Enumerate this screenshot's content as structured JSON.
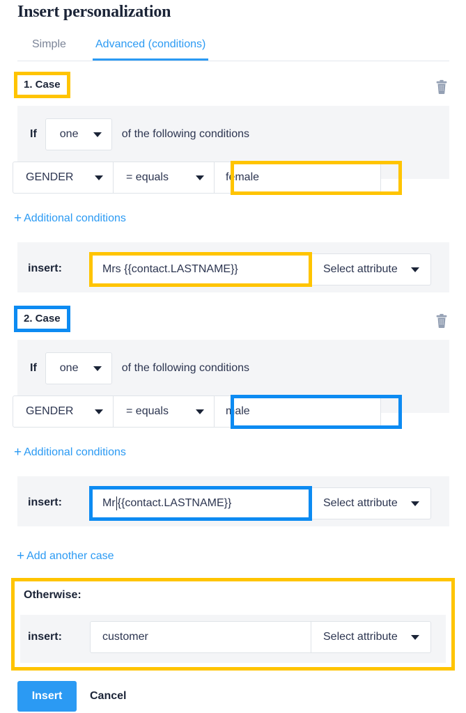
{
  "dialog": {
    "title": "Insert personalization",
    "tabs": [
      {
        "label": "Simple",
        "active": false
      },
      {
        "label": "Advanced (conditions)",
        "active": true
      }
    ],
    "accent_color": "#2b9af3",
    "highlight_yellow": "#ffc400",
    "highlight_blue": "#0d8bf2"
  },
  "cases": [
    {
      "label": "1. Case",
      "delete_icon": "trash-icon",
      "if_word": "If",
      "match_select": "one",
      "if_tail": "of the following conditions",
      "condition": {
        "attribute": "GENDER",
        "operator": "= equals",
        "value": "female"
      },
      "additional_conditions_link": "Additional conditions",
      "insert_label": "insert:",
      "insert_value": "Mrs {{contact.LASTNAME}}",
      "select_attribute": "Select attribute"
    },
    {
      "label": "2. Case",
      "delete_icon": "trash-icon",
      "if_word": "If",
      "match_select": "one",
      "if_tail": "of the following conditions",
      "condition": {
        "attribute": "GENDER",
        "operator": "= equals",
        "value": "male"
      },
      "additional_conditions_link": "Additional conditions",
      "insert_label": "insert:",
      "insert_value_before_cursor": "Mr ",
      "insert_value_after_cursor": "{{contact.LASTNAME}}",
      "select_attribute": "Select attribute"
    }
  ],
  "add_case_link": "Add another case",
  "plus_glyph": "+",
  "otherwise": {
    "label": "Otherwise:",
    "insert_label": "insert:",
    "insert_value": "customer",
    "select_attribute": "Select attribute"
  },
  "footer": {
    "primary": "Insert",
    "secondary": "Cancel"
  }
}
